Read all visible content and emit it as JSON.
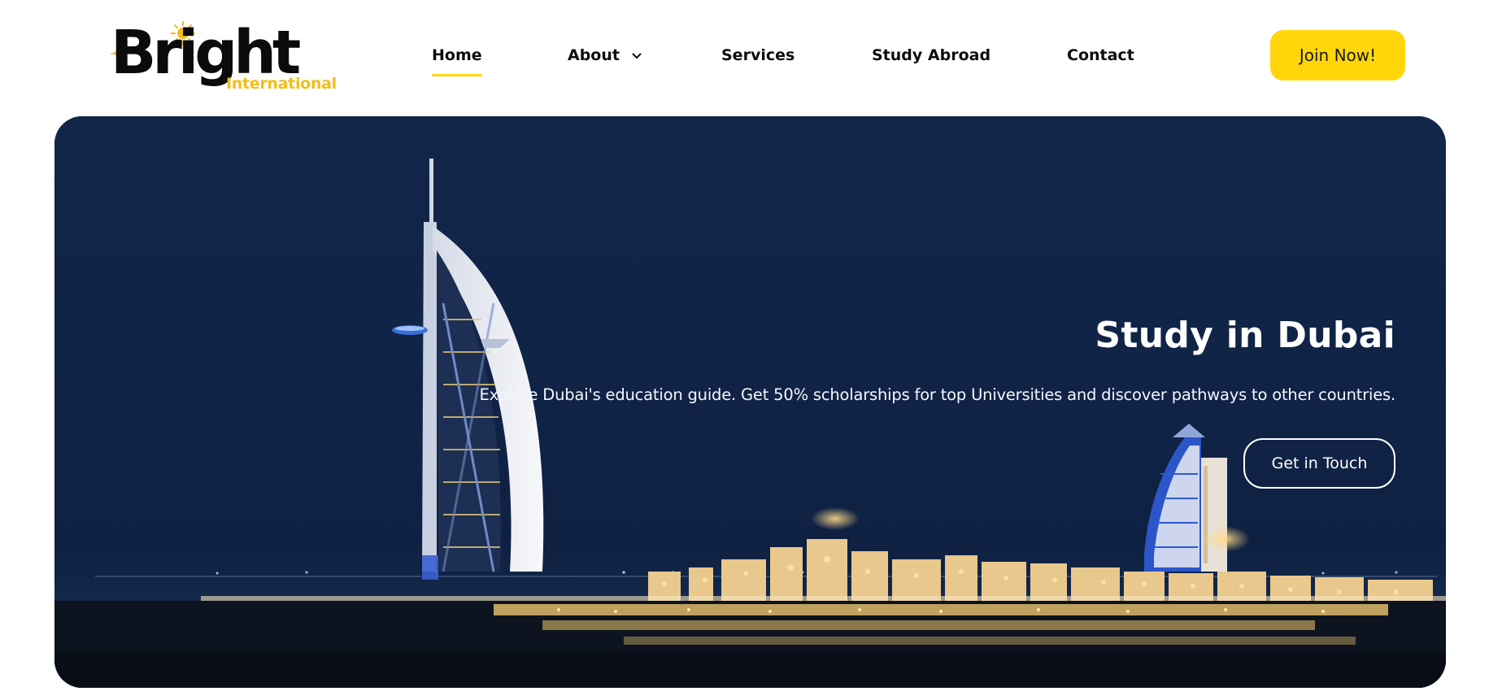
{
  "brand": {
    "name": "Bright",
    "sub": "International",
    "accent_color": "#ffd60a",
    "sub_color": "#f2bd18",
    "icons": [
      "sun-icon",
      "airplane-icon"
    ]
  },
  "nav": {
    "items": [
      {
        "label": "Home",
        "active": true
      },
      {
        "label": "About",
        "has_dropdown": true
      },
      {
        "label": "Services"
      },
      {
        "label": "Study Abroad"
      },
      {
        "label": "Contact"
      }
    ],
    "cta_label": "Join Now!"
  },
  "hero": {
    "title": "Study in Dubai",
    "description": "Explore Dubai's education guide. Get 50% scholarships for top Universities and discover pathways to other countries.",
    "button_label": "Get in Touch",
    "background": "night skyline of Dubai with Burj Al Arab"
  }
}
